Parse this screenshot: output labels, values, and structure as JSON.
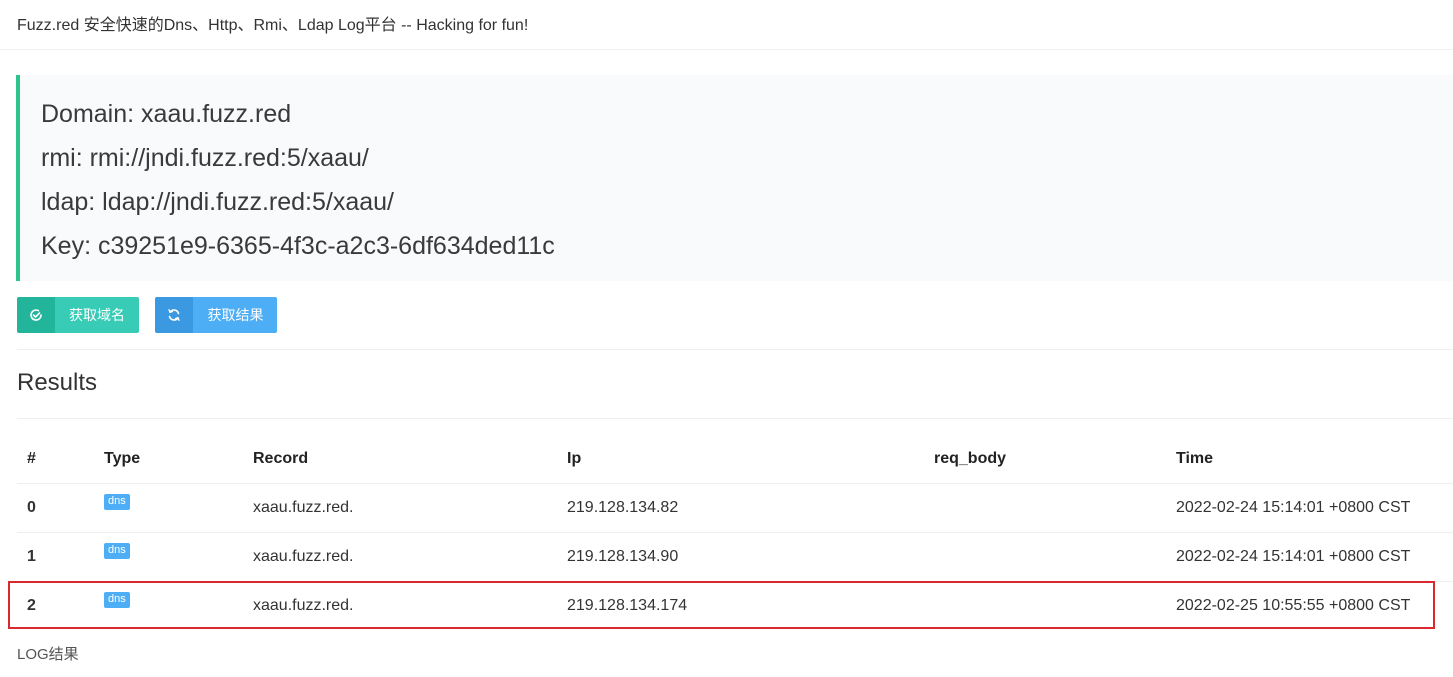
{
  "header": {
    "title": "Fuzz.red 安全快速的Dns、Http、Rmi、Ldap Log平台 -- Hacking for fun!"
  },
  "info": {
    "domain": "Domain: xaau.fuzz.red",
    "rmi": "rmi: rmi://jndi.fuzz.red:5/xaau/",
    "ldap": "ldap: ldap://jndi.fuzz.red:5/xaau/",
    "key": "Key: c39251e9-6365-4f3c-a2c3-6df634ded11c"
  },
  "buttons": {
    "get_domain": {
      "label": "获取域名",
      "icon": "check-circle-icon",
      "color": "#38ccb7"
    },
    "get_results": {
      "label": "获取结果",
      "icon": "refresh-icon",
      "color": "#4eaef5"
    }
  },
  "results": {
    "title": "Results",
    "columns": [
      "#",
      "Type",
      "Record",
      "Ip",
      "req_body",
      "Time"
    ],
    "rows": [
      {
        "index": "0",
        "type": "dns",
        "record": "xaau.fuzz.red.",
        "ip": "219.128.134.82",
        "req_body": "",
        "time": "2022-02-24 15:14:01 +0800 CST"
      },
      {
        "index": "1",
        "type": "dns",
        "record": "xaau.fuzz.red.",
        "ip": "219.128.134.90",
        "req_body": "",
        "time": "2022-02-24 15:14:01 +0800 CST"
      },
      {
        "index": "2",
        "type": "dns",
        "record": "xaau.fuzz.red.",
        "ip": "219.128.134.174",
        "req_body": "",
        "time": "2022-02-25 10:55:55 +0800 CST"
      }
    ],
    "highlight_color": "#d9292e"
  },
  "footer": {
    "caption": "LOG结果"
  },
  "colors": {
    "accent_green": "#2fc48d",
    "badge_blue": "#4eaef5"
  }
}
